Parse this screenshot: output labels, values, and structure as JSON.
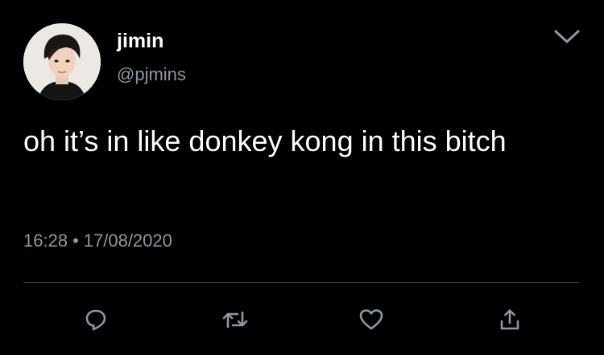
{
  "tweet": {
    "display_name": "jimin",
    "handle": "@pjmins",
    "text": "oh it’s in like donkey kong in this bitch",
    "time": "16:28",
    "separator": "•",
    "date": "17/08/2020"
  },
  "icons": {
    "caret": "chevron-down-icon",
    "reply": "reply-icon",
    "retweet": "retweet-icon",
    "like": "heart-icon",
    "share": "share-icon"
  },
  "colors": {
    "background": "#000000",
    "text": "#ffffff",
    "secondary": "#8b98a5",
    "divider": "#38444d"
  }
}
